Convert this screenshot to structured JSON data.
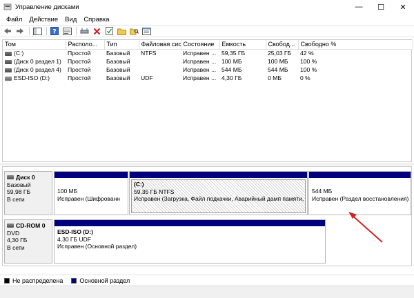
{
  "window": {
    "title": "Управление дисками",
    "minimize": "—",
    "maximize": "☐",
    "close": "✕"
  },
  "menu": [
    "Файл",
    "Действие",
    "Вид",
    "Справка"
  ],
  "columns": [
    "Том",
    "Располо...",
    "Тип",
    "Файловая система",
    "Состояние",
    "Емкость",
    "Свобод...",
    "Свободно %"
  ],
  "volumes": [
    [
      "(C:)",
      "Простой",
      "Базовый",
      "NTFS",
      "Исправен ...",
      "59,35 ГБ",
      "25,03 ГБ",
      "42 %"
    ],
    [
      "(Диск 0 раздел 1)",
      "Простой",
      "Базовый",
      "",
      "Исправен ...",
      "100 МБ",
      "100 МБ",
      "100 %"
    ],
    [
      "(Диск 0 раздел 4)",
      "Простой",
      "Базовый",
      "",
      "Исправен ...",
      "544 МБ",
      "544 МБ",
      "100 %"
    ],
    [
      "ESD-ISO (D:)",
      "Простой",
      "Базовый",
      "UDF",
      "Исправен ...",
      "4,30 ГБ",
      "0 МБ",
      "0 %"
    ]
  ],
  "disks": [
    {
      "name": "Диск 0",
      "type": "Базовый",
      "size": "59,98 ГБ",
      "status": "В сети",
      "partitions": [
        {
          "line1": "",
          "line2": "100 МБ",
          "line3": "Исправен (Шифрованн"
        },
        {
          "line1": "(C:)",
          "line2": "59,35 ГБ NTFS",
          "line3": "Исправен (Загрузка, Файл подкачки, Аварийный дамп памяти,"
        },
        {
          "line1": "",
          "line2": "544 МБ",
          "line3": "Исправен (Раздел восстановления)"
        }
      ]
    },
    {
      "name": "CD-ROM 0",
      "type": "DVD",
      "size": "4,30 ГБ",
      "status": "В сети",
      "partitions": [
        {
          "line1": "ESD-ISO  (D:)",
          "line2": "4,30 ГБ UDF",
          "line3": "Исправен (Основной раздел)"
        }
      ]
    }
  ],
  "legend": [
    {
      "label": "Не распределена",
      "color": "#000000"
    },
    {
      "label": "Основной раздел",
      "color": "#00007e"
    }
  ],
  "colors": {
    "primary_partition": "#00007e",
    "arrow": "#d42020"
  }
}
